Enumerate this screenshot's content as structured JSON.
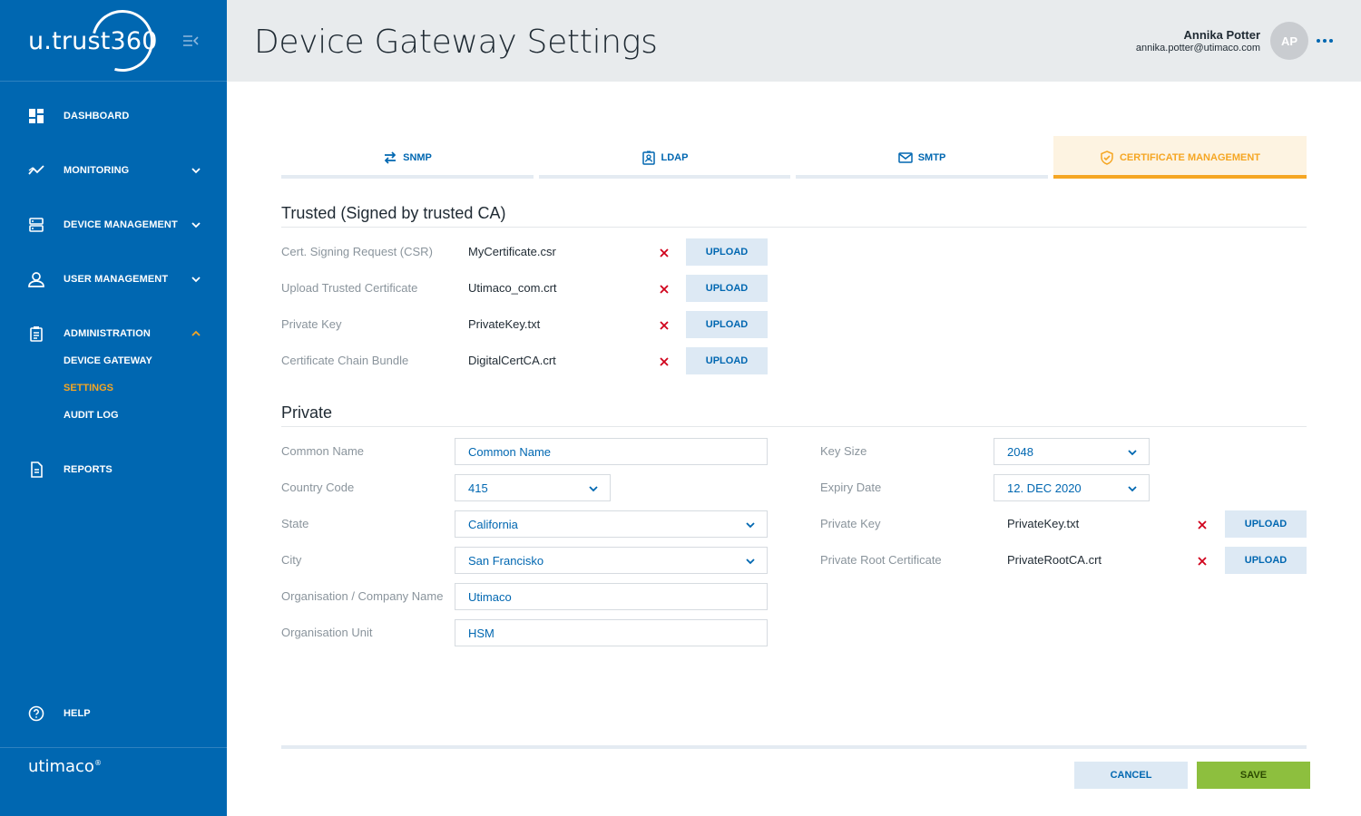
{
  "app": {
    "logo": "u.trust360",
    "brand": "utimaco",
    "brand_mark": "®"
  },
  "sidebar": {
    "items": [
      {
        "label": "DASHBOARD",
        "icon": "dashboard-icon"
      },
      {
        "label": "MONITORING",
        "icon": "monitoring-icon"
      },
      {
        "label": "DEVICE MANAGEMENT",
        "icon": "server-icon"
      },
      {
        "label": "USER MANAGEMENT",
        "icon": "user-icon"
      },
      {
        "label": "ADMINISTRATION",
        "icon": "clipboard-icon"
      },
      {
        "label": "REPORTS",
        "icon": "document-icon"
      },
      {
        "label": "HELP",
        "icon": "help-icon"
      }
    ],
    "sub_items": [
      "DEVICE GATEWAY",
      "SETTINGS",
      "AUDIT LOG"
    ],
    "colors": {
      "background": "#0067b1",
      "active": "#f5a623"
    }
  },
  "header": {
    "title": "Device Gateway Settings",
    "user_name": "Annika Potter",
    "user_email": "annika.potter@utimaco.com",
    "avatar_initials": "AP"
  },
  "tabs": [
    {
      "label": "SNMP",
      "icon": "swap-icon"
    },
    {
      "label": "LDAP",
      "icon": "contact-card-icon"
    },
    {
      "label": "SMTP",
      "icon": "mail-icon"
    },
    {
      "label": "CERTIFICATE MANAGEMENT",
      "icon": "shield-check-icon",
      "active": true
    }
  ],
  "trusted": {
    "title": "Trusted (Signed by trusted CA)",
    "rows": [
      {
        "label": "Cert. Signing Request (CSR)",
        "file": "MyCertificate.csr",
        "button": "UPLOAD"
      },
      {
        "label": "Upload Trusted Certificate",
        "file": "Utimaco_com.crt",
        "button": "UPLOAD"
      },
      {
        "label": "Private Key",
        "file": "PrivateKey.txt",
        "button": "UPLOAD"
      },
      {
        "label": "Certificate Chain Bundle",
        "file": "DigitalCertCA.crt",
        "button": "UPLOAD"
      }
    ]
  },
  "private": {
    "title": "Private",
    "left": [
      {
        "label": "Common Name",
        "value": "Common Name"
      },
      {
        "label": "Country Code",
        "value": "415"
      },
      {
        "label": "State",
        "value": "California"
      },
      {
        "label": "City",
        "value": "San Francisko"
      },
      {
        "label": "Organisation / Company Name",
        "value": "Utimaco"
      },
      {
        "label": "Organisation Unit",
        "value": "HSM"
      }
    ],
    "right": [
      {
        "label": "Key Size",
        "value": "2048"
      },
      {
        "label": "Expiry Date",
        "value": "12. DEC 2020"
      },
      {
        "label": "Private Key",
        "file": "PrivateKey.txt",
        "button": "UPLOAD"
      },
      {
        "label": "Private Root Certificate",
        "file": "PrivateRootCA.crt",
        "button": "UPLOAD"
      }
    ]
  },
  "footer": {
    "cancel_label": "CANCEL",
    "save_label": "SAVE"
  }
}
